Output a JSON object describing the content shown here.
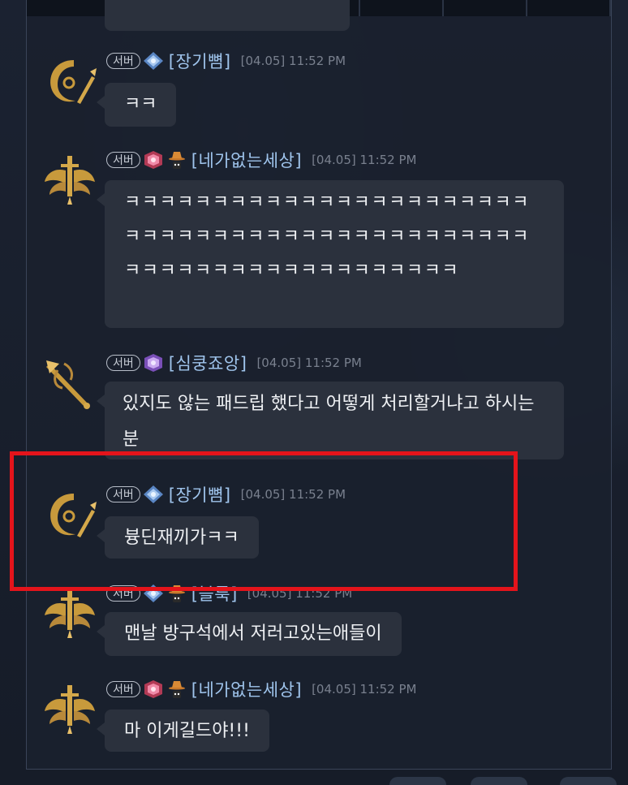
{
  "server_badge": "서버",
  "messages": [
    {
      "nick": "[장기뼘]",
      "time": "[04.05] 11:52 PM",
      "text": "ㅋㅋ",
      "avatar": "crescent-emblem-icon",
      "rank": "diamond-rank-icon"
    },
    {
      "nick": "[네가없는세상]",
      "time": "[04.05] 11:52 PM",
      "text": "ㅋㅋㅋㅋㅋㅋㅋㅋㅋㅋㅋㅋㅋㅋㅋㅋㅋㅋㅋㅋㅋㅋㅋㅋㅋㅋㅋㅋㅋㅋㅋㅋㅋㅋㅋㅋㅋㅋㅋㅋㅋㅋㅋㅋㅋㅋㅋㅋㅋㅋㅋㅋㅋㅋㅋㅋㅋㅋㅋㅋㅋㅋㅋㅋㅋ",
      "avatar": "winged-sword-icon",
      "rank": "crimson-rank-icon"
    },
    {
      "nick": "[심쿵죠앙]",
      "time": "[04.05] 11:52 PM",
      "text": "있지도 않는 패드립 했다고 어떻게 처리할거냐고 하시는분",
      "avatar": "spear-emblem-icon",
      "rank": "violet-rank-icon"
    },
    {
      "nick": "[장기뼘]",
      "time": "[04.05] 11:52 PM",
      "text": "븅딘재끼가ㅋㅋ",
      "avatar": "crescent-emblem-icon",
      "rank": "diamond-rank-icon"
    },
    {
      "nick": "[블룩]",
      "time": "[04.05] 11:52 PM",
      "text": "맨날 방구석에서 저러고있는애들이",
      "avatar": "winged-sword-icon",
      "rank": "diamond-rank-icon"
    },
    {
      "nick": "[네가없는세상]",
      "time": "[04.05] 11:52 PM",
      "text": "마 이게길드야!!!",
      "avatar": "winged-sword-icon",
      "rank": "crimson-rank-icon"
    }
  ],
  "highlight_color": "#e4141b",
  "nick_color": "#9fc4ec"
}
